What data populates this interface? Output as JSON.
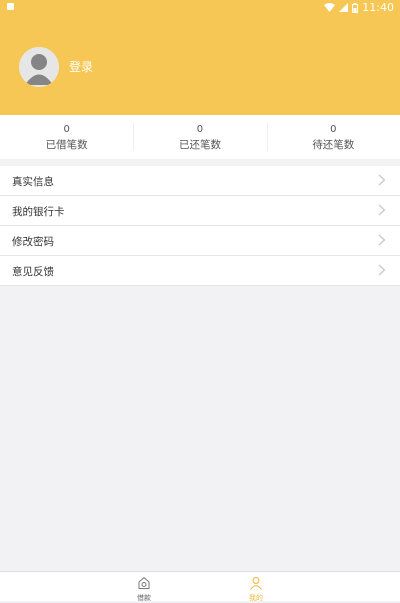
{
  "status_bar": {
    "time": "11:40"
  },
  "profile": {
    "login_label": "登录"
  },
  "stats": [
    {
      "value": "0",
      "label": "已借笔数"
    },
    {
      "value": "0",
      "label": "已还笔数"
    },
    {
      "value": "0",
      "label": "待还笔数"
    }
  ],
  "menu": [
    {
      "label": "真实信息"
    },
    {
      "label": "我的银行卡"
    },
    {
      "label": "修改密码"
    },
    {
      "label": "意见反馈"
    }
  ],
  "tabbar": [
    {
      "label": "借款",
      "icon": "loan-icon",
      "active": false
    },
    {
      "label": "我的",
      "icon": "person-icon",
      "active": true
    }
  ],
  "colors": {
    "header": "#f6c755",
    "active_tab": "#f0b636",
    "page_bg": "#f2f2f4"
  }
}
